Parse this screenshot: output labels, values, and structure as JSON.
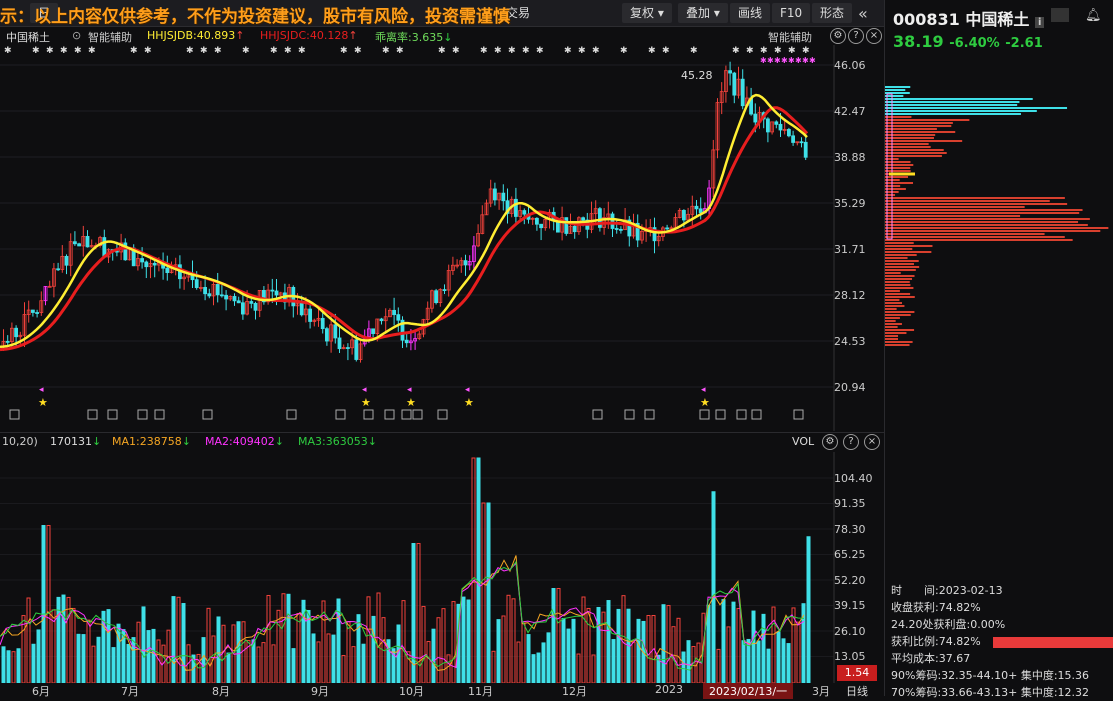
{
  "toolbar": {
    "period_button": "日",
    "fuquan_button": "复权",
    "overlay_button": "叠加",
    "draw_button": "画线",
    "f10_button": "F10",
    "shape_button": "形态",
    "trade_button": "交易"
  },
  "banner": "示：以上内容仅供参考，不作为投资建议，股市有风险，投资需谨慎",
  "legend": {
    "name": "中国稀土",
    "assist": "智能辅助",
    "jdb": "HHJSJDB:40.893",
    "jdc": "HHJSJDC:40.128",
    "deviation": "乖离率:3.635",
    "assist_right": "智能辅助"
  },
  "price_axis": [
    "46.06",
    "42.47",
    "38.88",
    "35.29",
    "31.71",
    "28.12",
    "24.53",
    "20.94"
  ],
  "high_label": "45.28",
  "volume": {
    "params": "10,20)",
    "current": "170131",
    "ma1": "MA1:238758",
    "ma2": "MA2:409402",
    "ma3": "MA3:363053",
    "title": "VOL",
    "axis": [
      "104.40",
      "91.35",
      "78.30",
      "65.25",
      "52.20",
      "39.15",
      "26.10",
      "13.05"
    ],
    "cursor_value": "1.54"
  },
  "x_axis": {
    "labels": [
      "6月",
      "7月",
      "8月",
      "9月",
      "10月",
      "11月",
      "12月",
      "2023",
      "3月"
    ],
    "cursor_date": "2023/02/13/一",
    "period": "日线"
  },
  "stock": {
    "code": "000831",
    "name": "中国稀土",
    "price": "38.19",
    "change_pct": "-6.40%",
    "change": "-2.61"
  },
  "chip_info": {
    "time": "时　　间:2023-02-13",
    "profit": "收盘获利:74.82%",
    "profit_at": "24.20处获利盘:0.00%",
    "profit_ratio": "获利比例:74.82%",
    "avg_cost": "平均成本:37.67",
    "chip90": "90%筹码:32.35-44.10+  集中度:15.36",
    "chip70": "70%筹码:33.66-43.13+  集中度:12.32"
  },
  "colors": {
    "up": "#f2423b",
    "down": "#3fe0e8",
    "yellow_line": "#ffee33",
    "red_line": "#e81e1e",
    "magenta": "#ff33ff",
    "banner": "#ff9e1a"
  }
}
